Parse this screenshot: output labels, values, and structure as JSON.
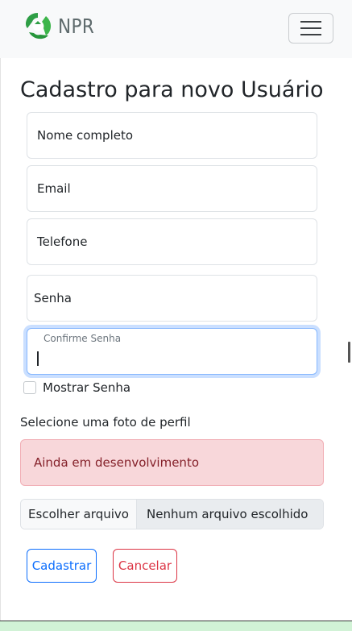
{
  "navbar": {
    "brand": "NPR",
    "logo_icon": "recycle-leaves-icon",
    "toggler_icon": "hamburger-menu-icon"
  },
  "form": {
    "title": "Cadastro para novo Usuário",
    "fields": {
      "nome": "Nome completo",
      "email": "Email",
      "telefone": "Telefone",
      "senha": "Senha",
      "confirme_senha": "Confirme Senha"
    },
    "show_password_label": "Mostrar Senha",
    "show_password_checked": false,
    "photo_label": "Selecione uma foto de perfil",
    "alert_text": "Ainda em desenvolvimento",
    "file_button": "Escolher arquivo",
    "file_status": "Nenhum arquivo escolhido",
    "submit_label": "Cadastrar",
    "cancel_label": "Cancelar"
  },
  "colors": {
    "primary": "#0d6efd",
    "danger": "#dc3545",
    "alert_bg": "#f8d7da",
    "brand_green": "#3aa64a"
  }
}
